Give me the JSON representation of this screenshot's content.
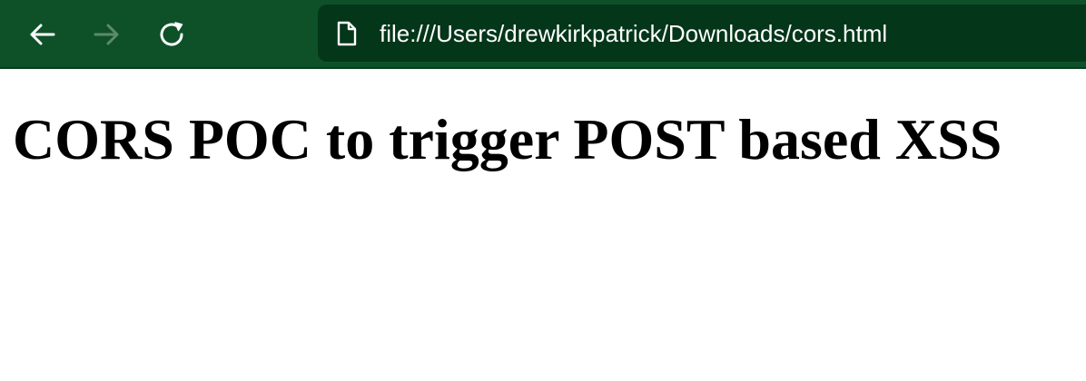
{
  "browser": {
    "toolbar_color": "#0e5129",
    "address_bar_color": "#043619",
    "back_icon": "arrow-left-icon",
    "forward_icon": "arrow-right-icon",
    "reload_icon": "reload-icon",
    "page_icon": "file-icon",
    "url": "file:///Users/drewkirkpatrick/Downloads/cors.html"
  },
  "page": {
    "heading": "CORS POC to trigger POST based XSS"
  }
}
